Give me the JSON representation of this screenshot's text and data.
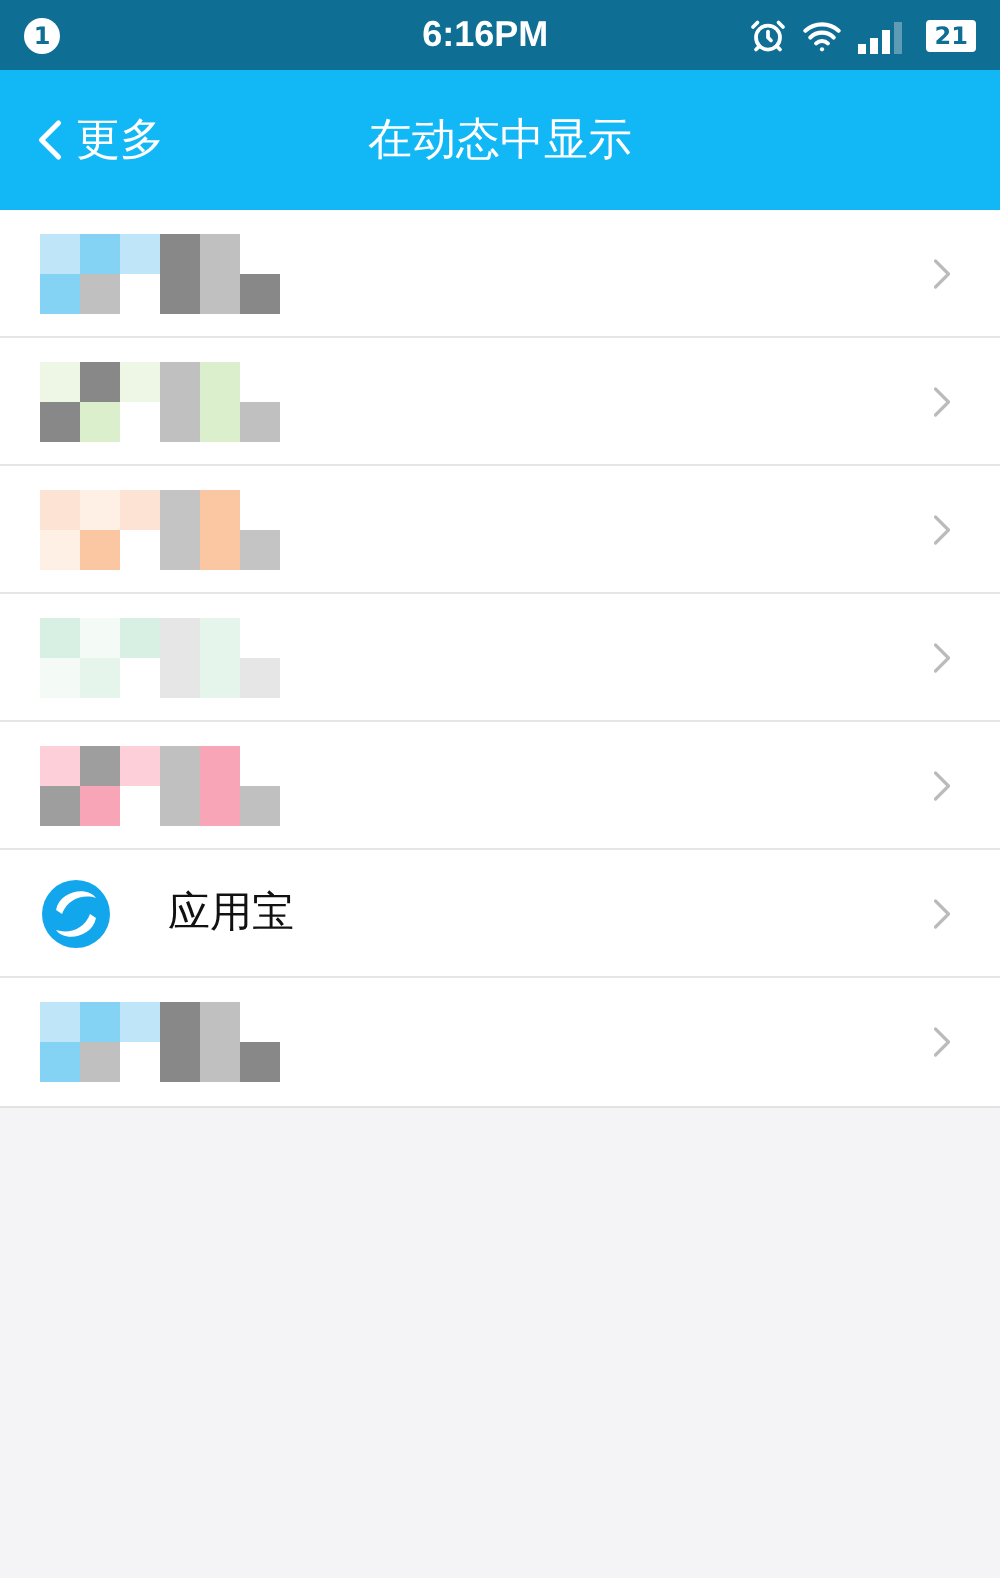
{
  "status_bar": {
    "notification_count": "1",
    "time": "6:16PM",
    "battery": "21"
  },
  "nav": {
    "back_label": "更多",
    "title": "在动态中显示"
  },
  "rows": [
    {
      "kind": "obscured"
    },
    {
      "kind": "obscured"
    },
    {
      "kind": "obscured"
    },
    {
      "kind": "obscured"
    },
    {
      "kind": "obscured"
    },
    {
      "kind": "app",
      "label": "应用宝"
    },
    {
      "kind": "obscured"
    }
  ]
}
